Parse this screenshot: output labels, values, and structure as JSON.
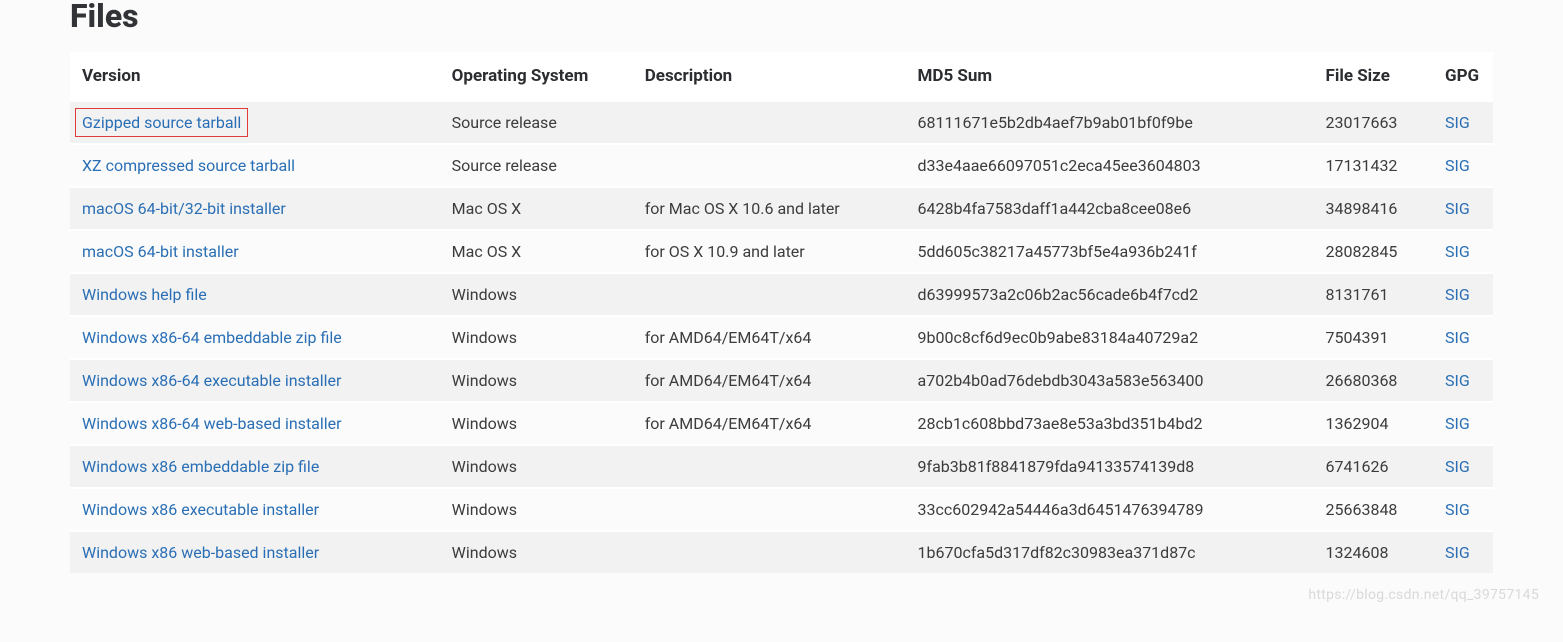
{
  "title": "Files",
  "watermark": "https://blog.csdn.net/qq_39757145",
  "table": {
    "headers": [
      "Version",
      "Operating System",
      "Description",
      "MD5 Sum",
      "File Size",
      "GPG"
    ],
    "sig_label": "SIG",
    "rows": [
      {
        "version": "Gzipped source tarball",
        "os": "Source release",
        "desc": "",
        "md5": "68111671e5b2db4aef7b9ab01bf0f9be",
        "size": "23017663",
        "highlight": true
      },
      {
        "version": "XZ compressed source tarball",
        "os": "Source release",
        "desc": "",
        "md5": "d33e4aae66097051c2eca45ee3604803",
        "size": "17131432"
      },
      {
        "version": "macOS 64-bit/32-bit installer",
        "os": "Mac OS X",
        "desc": "for Mac OS X 10.6 and later",
        "md5": "6428b4fa7583daff1a442cba8cee08e6",
        "size": "34898416"
      },
      {
        "version": "macOS 64-bit installer",
        "os": "Mac OS X",
        "desc": "for OS X 10.9 and later",
        "md5": "5dd605c38217a45773bf5e4a936b241f",
        "size": "28082845"
      },
      {
        "version": "Windows help file",
        "os": "Windows",
        "desc": "",
        "md5": "d63999573a2c06b2ac56cade6b4f7cd2",
        "size": "8131761"
      },
      {
        "version": "Windows x86-64 embeddable zip file",
        "os": "Windows",
        "desc": "for AMD64/EM64T/x64",
        "md5": "9b00c8cf6d9ec0b9abe83184a40729a2",
        "size": "7504391"
      },
      {
        "version": "Windows x86-64 executable installer",
        "os": "Windows",
        "desc": "for AMD64/EM64T/x64",
        "md5": "a702b4b0ad76debdb3043a583e563400",
        "size": "26680368"
      },
      {
        "version": "Windows x86-64 web-based installer",
        "os": "Windows",
        "desc": "for AMD64/EM64T/x64",
        "md5": "28cb1c608bbd73ae8e53a3bd351b4bd2",
        "size": "1362904"
      },
      {
        "version": "Windows x86 embeddable zip file",
        "os": "Windows",
        "desc": "",
        "md5": "9fab3b81f8841879fda94133574139d8",
        "size": "6741626"
      },
      {
        "version": "Windows x86 executable installer",
        "os": "Windows",
        "desc": "",
        "md5": "33cc602942a54446a3d6451476394789",
        "size": "25663848"
      },
      {
        "version": "Windows x86 web-based installer",
        "os": "Windows",
        "desc": "",
        "md5": "1b670cfa5d317df82c30983ea371d87c",
        "size": "1324608"
      }
    ]
  }
}
